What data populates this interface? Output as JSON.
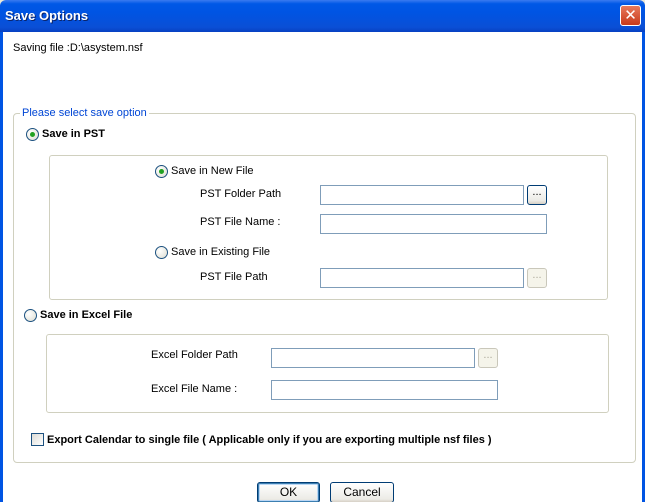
{
  "window": {
    "title": "Save Options",
    "close_glyph": "✕"
  },
  "saving_file": "Saving file :D:\\asystem.nsf",
  "group": {
    "legend": "Please select save option"
  },
  "pst": {
    "label": "Save in PST",
    "new_file": {
      "label": "Save in New File",
      "folder_path_label": "PST Folder Path",
      "folder_path_value": "",
      "file_name_label": "PST File Name :",
      "file_name_value": "",
      "browse_label": "..."
    },
    "existing_file": {
      "label": "Save in Existing File",
      "file_path_label": "PST File Path",
      "file_path_value": "",
      "browse_label": "..."
    }
  },
  "excel": {
    "label": "Save in Excel File",
    "folder_path_label": "Excel Folder Path",
    "folder_path_value": "",
    "file_name_label": "Excel File Name :",
    "file_name_value": "",
    "browse_label": "..."
  },
  "calendar_option": {
    "label": "Export Calendar to single file ( Applicable only if you are exporting multiple nsf files )",
    "checked": false
  },
  "buttons": {
    "ok": "OK",
    "cancel": "Cancel"
  },
  "state": {
    "save_in_pst": true,
    "save_in_new_file": true
  },
  "colors": {
    "titlebar": "#0054e3",
    "legend_text": "#0046d5",
    "radio_dot": "#21a121"
  }
}
